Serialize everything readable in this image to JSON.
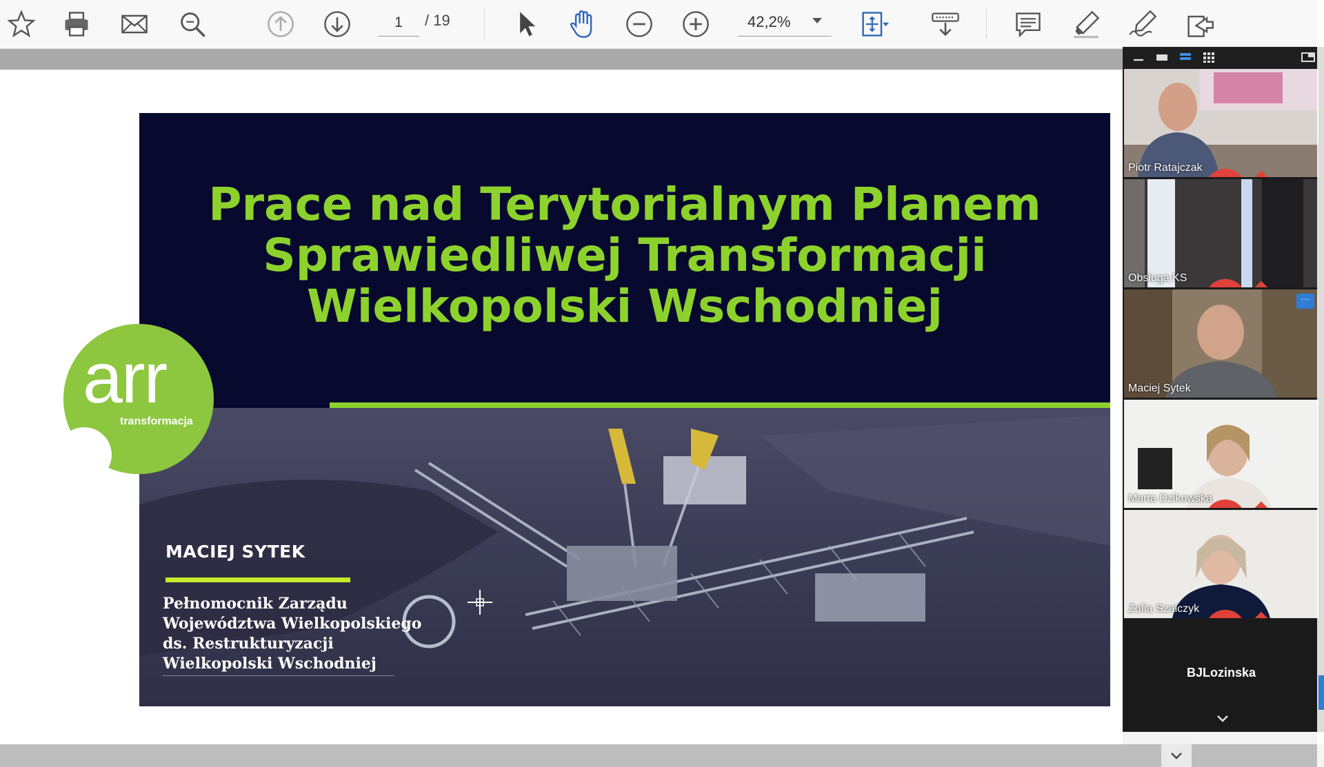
{
  "toolbar": {
    "icons": {
      "bookmark": "star-icon",
      "print": "printer-icon",
      "email": "mail-icon",
      "search": "search-icon",
      "prev_page": "arrow-up-circle-icon",
      "next_page": "arrow-down-circle-icon",
      "select": "pointer-icon",
      "pan": "hand-icon",
      "zoom_out": "zoom-out-icon",
      "zoom_in": "zoom-in-icon",
      "fit": "fit-page-icon",
      "scroll_mode": "scroll-mode-icon",
      "comment": "comment-icon",
      "highlight": "highlighter-icon",
      "sign": "sign-pen-icon",
      "share": "share-icon"
    },
    "page_current": "1",
    "page_total": "/ 19",
    "zoom": "42,2%"
  },
  "slide": {
    "title_lines": [
      "Prace nad Terytorialnym Planem",
      "Sprawiedliwej Transformacji",
      "Wielkopolski Wschodniej"
    ],
    "presenter_name": "MACIEJ SYTEK",
    "presenter_role_lines": [
      "Pełnomocnik Zarządu",
      "Województwa Wielkopolskiego",
      "ds. Restrukturyzacji",
      "Wielkopolski Wschodniej"
    ],
    "logo_main": "arr",
    "logo_sub": "transformacja",
    "colors": {
      "background": "#08092e",
      "accent_green": "#8dd22c",
      "logo_green": "#8dc63f"
    }
  },
  "video_panel": {
    "participants": [
      {
        "name": "Piotr Ratajczak",
        "muted": true
      },
      {
        "name": "Obsługa KS",
        "muted": true
      },
      {
        "name": "Maciej Sytek",
        "muted": false,
        "active_speaker": true
      },
      {
        "name": "Marta Dzikowska",
        "muted": true
      },
      {
        "name": "Zofia Szalczyk",
        "muted": true
      },
      {
        "name": "BJLozinska",
        "muted": true,
        "video_off": true
      }
    ],
    "more_button": "···"
  }
}
